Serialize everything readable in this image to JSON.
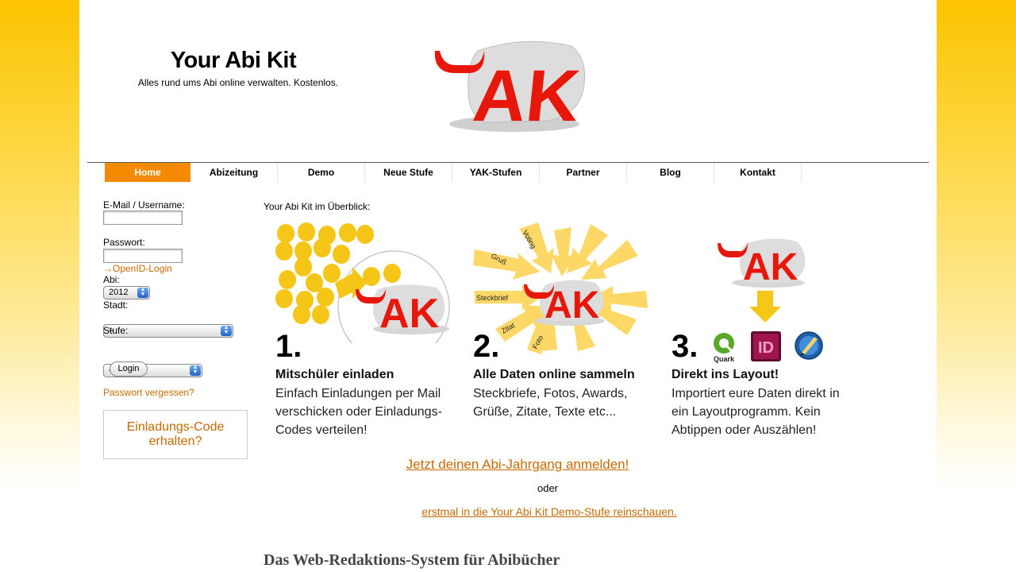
{
  "header": {
    "title": "Your Abi Kit",
    "tagline": "Alles rund ums Abi online verwalten. Kostenlos.",
    "logo_text": "AK"
  },
  "nav": {
    "items": [
      {
        "label": "Home",
        "active": true
      },
      {
        "label": "Abizeitung"
      },
      {
        "label": "Demo"
      },
      {
        "label": "Neue Stufe"
      },
      {
        "label": "YAK-Stufen"
      },
      {
        "label": "Partner"
      },
      {
        "label": "Blog"
      },
      {
        "label": "Kontakt"
      }
    ]
  },
  "login": {
    "email_label": "E-Mail / Username:",
    "email_value": "",
    "password_label": "Passwort:",
    "password_value": "",
    "openid_link": "→OpenID-Login",
    "abi_label": "Abi:",
    "abi_value": "2012",
    "stadt_label": "Stadt:",
    "stadt_value": "–",
    "stufe_label": "Stufe:",
    "stufe_value": "–",
    "login_button": "Login",
    "forgot_link": "Passwort vergessen?",
    "invite_code": "Einladungs-Code erhalten?"
  },
  "main": {
    "overview_label": "Your Abi Kit im Überblick:",
    "steps": [
      {
        "number": "1.",
        "title": "Mitschüler einladen",
        "text": "Einfach Einladungen per Mail verschicken oder Einladungs-Codes verteilen!"
      },
      {
        "number": "2.",
        "title": "Alle Daten online sammeln",
        "text": "Steckbriefe, Fotos, Awards, Grüße, Zitate, Texte etc..."
      },
      {
        "number": "3.",
        "title": "Direkt ins Layout!",
        "text": "Importiert eure Daten direkt in ein Layoutprogramm. Kein Abtippen oder Auszählen!"
      }
    ],
    "arrow_labels": [
      "Voting",
      "Gruß",
      "Steckbrief",
      "Zitat",
      "Foto"
    ],
    "quark_label": "Quark",
    "indesign_label": "ID",
    "cta_register": "Jetzt deinen Abi-Jahrgang anmelden!",
    "cta_or": "oder",
    "cta_demo": "erstmal in die Your Abi Kit Demo-Stufe reinschauen.",
    "bottom_heading": "Das Web-Redaktions-System für Abibücher"
  },
  "colors": {
    "brand_red": "#e8170c",
    "brand_orange": "#f58a00",
    "link_orange": "#c76a00",
    "background_yellow": "#fcc400",
    "chick_yellow": "#f5c518",
    "arrow_yellow": "#fdd867"
  }
}
